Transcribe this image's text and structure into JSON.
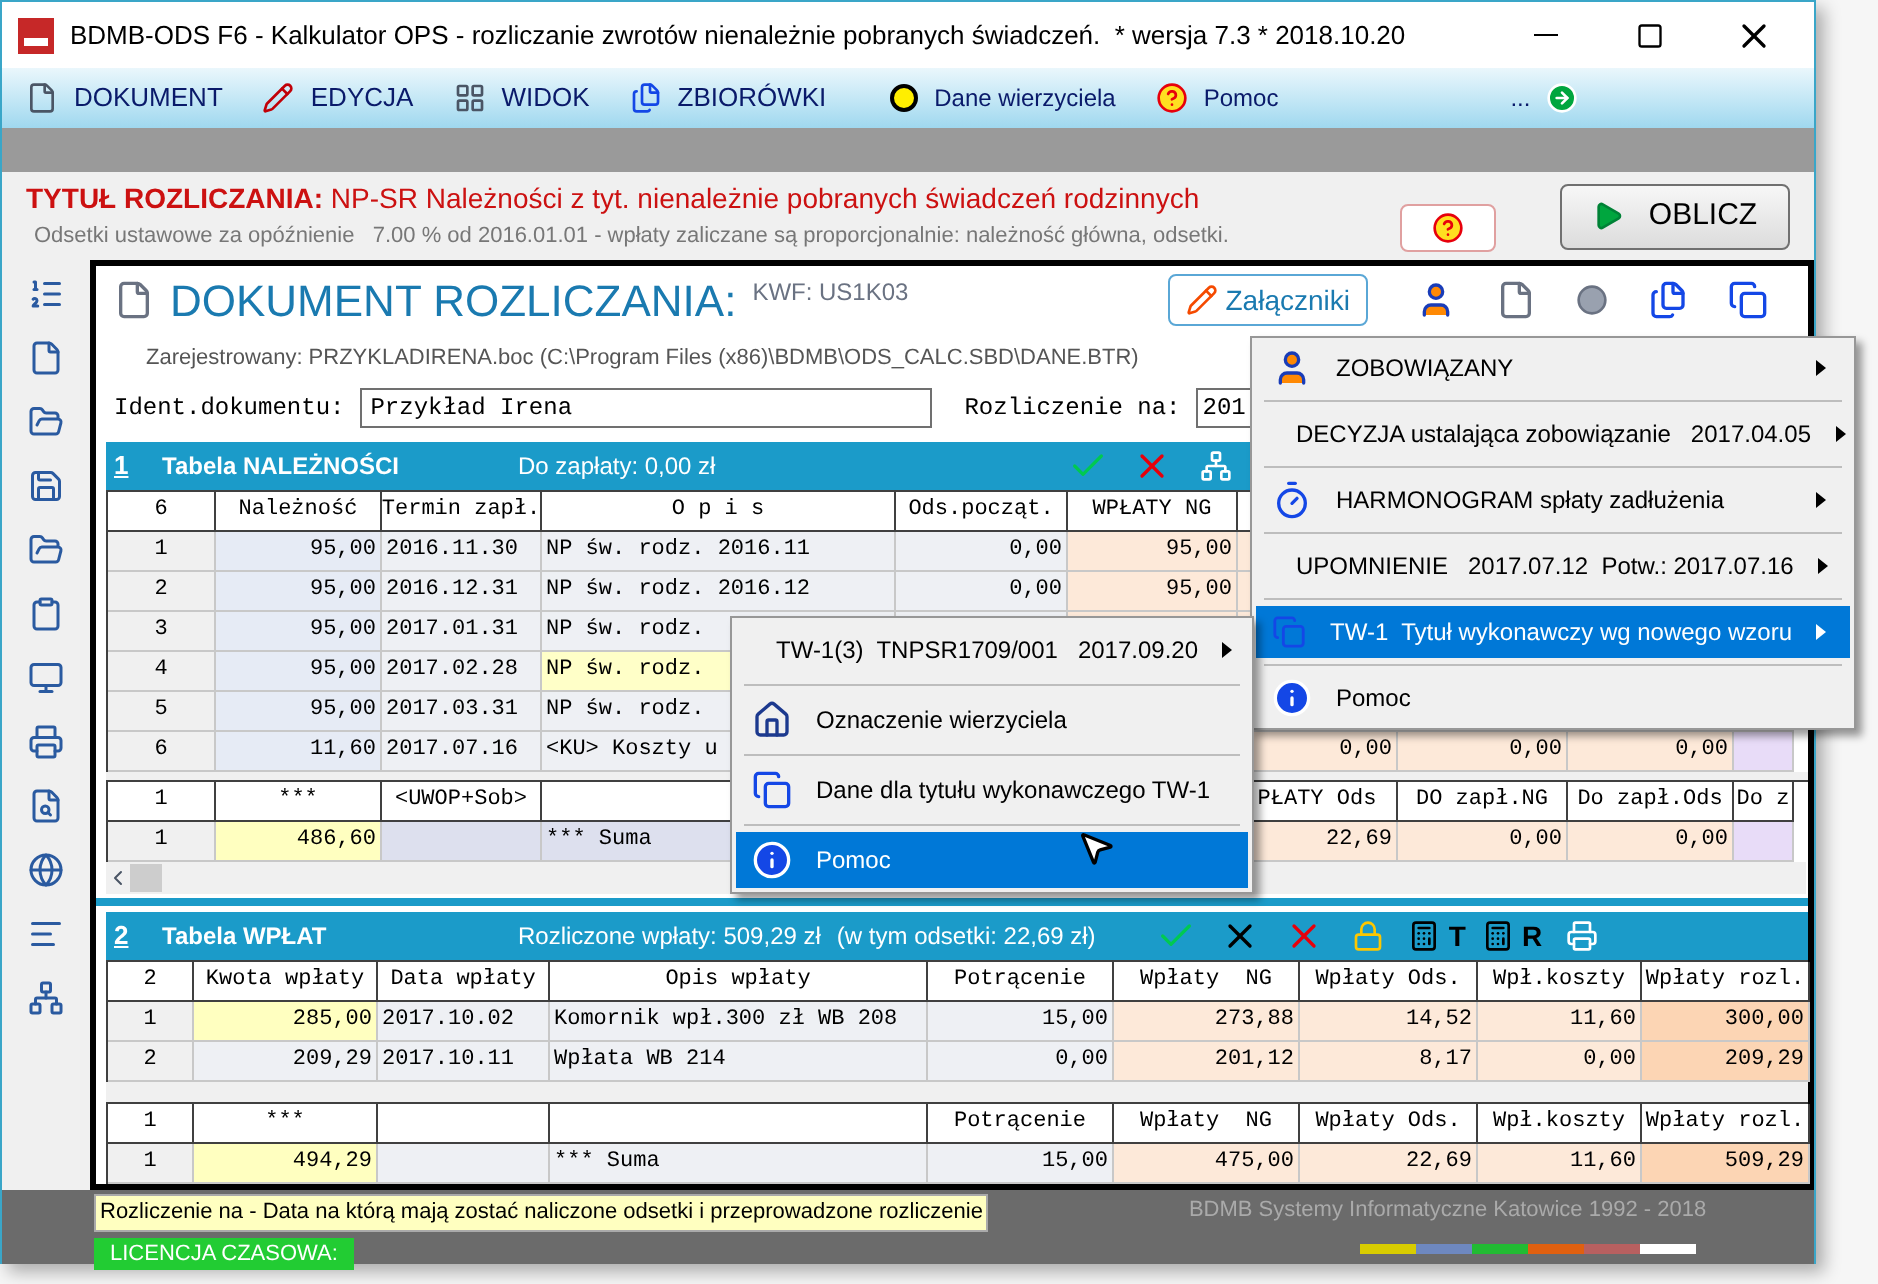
{
  "window": {
    "title": "BDMB-ODS F6 - Kalkulator OPS - rozliczanie zwrotów nienależnie pobranych świadczeń.  * wersja 7.3 * 2018.10.20"
  },
  "menu": [
    {
      "label": "DOKUMENT"
    },
    {
      "label": "EDYCJA"
    },
    {
      "label": "WIDOK"
    },
    {
      "label": "ZBIORÓWKI"
    },
    {
      "label": "Dane wierzyciela"
    },
    {
      "label": "Pomoc"
    },
    {
      "label": "..."
    }
  ],
  "header": {
    "title_label": "TYTUŁ ROZLICZANIA:",
    "title_value": "NP-SR Należności z tyt. nienależnie pobranych świadczeń rodzinnych",
    "subtitle": "Odsetki ustawowe za opóźnienie   7.00 % od 2016.01.01 - wpłaty zaliczane są proporcjonalnie: należność główna, odsetki.",
    "calc_button": "OBLICZ"
  },
  "document": {
    "title": "DOKUMENT ROZLICZANIA:",
    "code": "KWF: US1K03",
    "attachments_button": "Załączniki",
    "registered": "Zarejestrowany: PRZYKLADIRENA.boc (C:\\Program Files (x86)\\BDMB\\ODS_CALC.SBD\\DANE.BTR)",
    "ident_label": "Ident.dokumentu:",
    "ident_value": "Przykład Irena",
    "date_label": "Rozliczenie na:",
    "date_value": "201"
  },
  "table1": {
    "number": "1",
    "title": "Tabela NALEŻNOŚCI",
    "summary": "Do zapłaty: 0,00 zł",
    "columns": [
      "6",
      "Należność",
      "Termin zapł.",
      "O p i s",
      "Ods.począt.",
      "WPŁATY NG",
      null,
      null,
      null,
      null
    ],
    "rows": [
      {
        "selected": false,
        "cells": [
          "1",
          "95,00",
          "2016.11.30",
          "NP św. rodz. 2016.11",
          "0,00",
          "95,00",
          null,
          null,
          null,
          null
        ]
      },
      {
        "selected": false,
        "cells": [
          "2",
          "95,00",
          "2016.12.31",
          "NP św. rodz. 2016.12",
          "0,00",
          "95,00",
          null,
          null,
          null,
          null
        ]
      },
      {
        "selected": false,
        "cells": [
          "3",
          "95,00",
          "2017.01.31",
          "NP św. rodz.",
          null,
          null,
          null,
          null,
          null,
          null
        ]
      },
      {
        "selected": true,
        "cells": [
          "4",
          "95,00",
          "2017.02.28",
          "NP św. rodz.",
          null,
          null,
          null,
          null,
          null,
          null
        ]
      },
      {
        "selected": false,
        "cells": [
          "5",
          "95,00",
          "2017.03.31",
          "NP św. rodz.",
          null,
          null,
          null,
          null,
          null,
          null
        ]
      },
      {
        "selected": false,
        "cells": [
          "6",
          "11,60",
          "2017.07.16",
          "<KU> Koszty u",
          null,
          null,
          "0,00",
          "0,00",
          "0,00",
          null
        ]
      }
    ],
    "sum_columns": [
      "1",
      "***",
      "<UWOP+Sob>",
      null,
      null,
      null,
      "PŁATY Ods",
      "DO zapł.NG",
      "Do zapł.Ods",
      "Do z"
    ],
    "sum_rows": [
      {
        "selected": true,
        "cells": [
          "1",
          "486,60",
          null,
          "*** Suma",
          null,
          null,
          "22,69",
          "0,00",
          "0,00",
          null
        ]
      }
    ]
  },
  "table2": {
    "number": "2",
    "title": "Tabela WPŁAT",
    "summary": "Rozliczone wpłaty: 509,29 zł",
    "summary_extra": "(w tym odsetki: 22,69 zł)",
    "tool_letters": [
      "T",
      "R"
    ],
    "columns": [
      "2",
      "Kwota wpłaty",
      "Data wpłaty",
      "Opis wpłaty",
      "Potrącenie",
      "Wpłaty  NG",
      "Wpłaty Ods.",
      "Wpł.koszty",
      "Wpłaty rozl."
    ],
    "rows": [
      {
        "selected": true,
        "cells": [
          "1",
          "285,00",
          "2017.10.02",
          "Komornik wpł.300 zł WB 208",
          "15,00",
          "273,88",
          "14,52",
          "11,60",
          "300,00"
        ]
      },
      {
        "selected": false,
        "cells": [
          "2",
          "209,29",
          "2017.10.11",
          "Wpłata WB 214",
          "0,00",
          "201,12",
          "8,17",
          "0,00",
          "209,29"
        ]
      }
    ],
    "sum_columns": [
      "1",
      "***",
      null,
      null,
      "Potrącenie",
      "Wpłaty  NG",
      "Wpłaty Ods.",
      "Wpł.koszty",
      "Wpłaty rozl."
    ],
    "sum_rows": [
      {
        "selected": true,
        "cells": [
          "1",
          "494,29",
          null,
          "*** Suma",
          "15,00",
          "475,00",
          "22,69",
          "11,60",
          "509,29"
        ]
      }
    ]
  },
  "attachments_menu": [
    {
      "label": "ZOBOWIĄZANY",
      "submenu": true,
      "selected": false
    },
    {
      "label": "DECYZJA ustalająca zobowiązanie   2017.04.05",
      "submenu": true,
      "selected": false
    },
    {
      "label": "HARMONOGRAM spłaty zadłużenia",
      "submenu": true,
      "selected": false
    },
    {
      "label": "UPOMNIENIE   2017.07.12  Potw.: 2017.07.16",
      "submenu": true,
      "selected": false
    },
    {
      "label": "TW-1  Tytuł wykonawczy wg nowego wzoru",
      "submenu": true,
      "selected": true
    },
    {
      "label": "Pomoc",
      "submenu": false,
      "selected": false
    }
  ],
  "context_menu": [
    {
      "label": "TW-1(3)  TNPSR1709/001   2017.09.20",
      "submenu": true,
      "selected": false
    },
    {
      "label": "Oznaczenie wierzyciela",
      "submenu": false,
      "selected": false
    },
    {
      "label": "Dane dla tytułu wykonawczego TW-1",
      "submenu": false,
      "selected": false
    },
    {
      "label": "Pomoc",
      "submenu": false,
      "selected": true
    }
  ],
  "status": {
    "hint": "Rozliczenie na - Data na którą mają zostać naliczone odsetki i przeprowadzone rozliczenie",
    "license": "LICENCJA CZASOWA:",
    "copyright": "BDMB Systemy Informatyczne Katowice 1992 - 2018"
  }
}
